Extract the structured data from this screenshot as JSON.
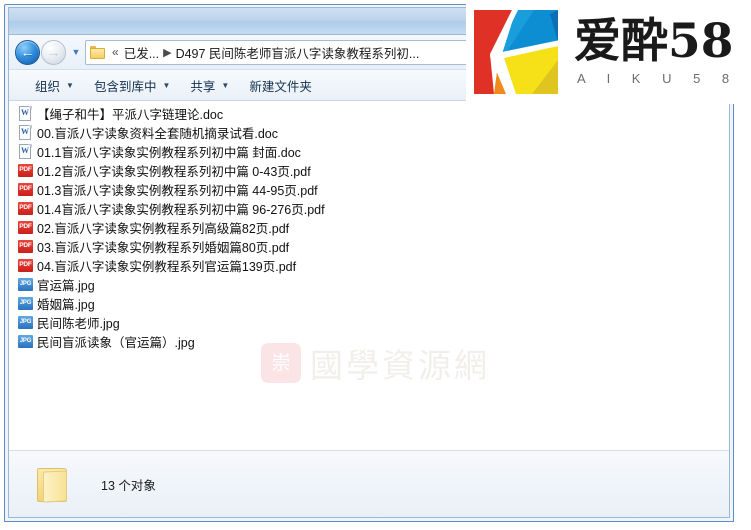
{
  "window": {
    "title": ""
  },
  "address_bar": {
    "back_button": "back-arrow",
    "forward_button": "forward-arrow",
    "history_dropdown": "▼",
    "folder_icon": "folder-icon",
    "crumb_overflow": "«",
    "crumb_parent": "已发...",
    "crumb_separator": "▶",
    "crumb_current": "D497 民间陈老师盲派八字读象教程系列初...",
    "dropdown_caret": "▾"
  },
  "toolbar": {
    "items": [
      {
        "label": "组织",
        "caret": "▼",
        "has_caret": true
      },
      {
        "label": "包含到库中",
        "caret": "▼",
        "has_caret": true
      },
      {
        "label": "共享",
        "caret": "▼",
        "has_caret": true
      },
      {
        "label": "新建文件夹",
        "caret": "",
        "has_caret": false
      }
    ]
  },
  "file_list": {
    "files": [
      {
        "name": "【绳子和牛】平派八字链理论.doc",
        "type": "doc",
        "icon_label": "W"
      },
      {
        "name": "00.盲派八字读象资料全套随机摘录试看.doc",
        "type": "doc",
        "icon_label": "W"
      },
      {
        "name": "01.1盲派八字读象实例教程系列初中篇 封面.doc",
        "type": "doc",
        "icon_label": "W"
      },
      {
        "name": "01.2盲派八字读象实例教程系列初中篇 0-43页.pdf",
        "type": "pdf",
        "icon_label": "PDF"
      },
      {
        "name": "01.3盲派八字读象实例教程系列初中篇 44-95页.pdf",
        "type": "pdf",
        "icon_label": "PDF"
      },
      {
        "name": "01.4盲派八字读象实例教程系列初中篇 96-276页.pdf",
        "type": "pdf",
        "icon_label": "PDF"
      },
      {
        "name": "02.盲派八字读象实例教程系列高级篇82页.pdf",
        "type": "pdf",
        "icon_label": "PDF"
      },
      {
        "name": "03.盲派八字读象实例教程系列婚姻篇80页.pdf",
        "type": "pdf",
        "icon_label": "PDF"
      },
      {
        "name": "04.盲派八字读象实例教程系列官运篇139页.pdf",
        "type": "pdf",
        "icon_label": "PDF"
      },
      {
        "name": "官运篇.jpg",
        "type": "jpg",
        "icon_label": "JPG"
      },
      {
        "name": "婚姻篇.jpg",
        "type": "jpg",
        "icon_label": "JPG"
      },
      {
        "name": "民间陈老师.jpg",
        "type": "jpg",
        "icon_label": "JPG"
      },
      {
        "name": "民间盲派读象（官运篇）.jpg",
        "type": "jpg",
        "icon_label": "JPG"
      }
    ]
  },
  "watermark": {
    "logo_glyph": "崇",
    "text": "國學資源網"
  },
  "status_bar": {
    "folder_icon": "folder-icon",
    "text": "13 个对象"
  },
  "brand": {
    "name_cn": "爱酔58",
    "name_en": "A I K U 5 8",
    "colors": {
      "red": "#e03127",
      "red_dark": "#c0392b",
      "blue": "#1a9ddb",
      "blue_dark": "#0e6fb5",
      "yellow": "#f6e018",
      "yellow_dark": "#e0c420",
      "orange": "#f08a1c"
    }
  }
}
